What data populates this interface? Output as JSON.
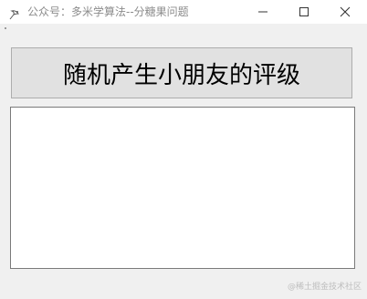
{
  "window": {
    "title": "公众号：多米学算法--分糖果问题",
    "icon": "app-feather-icon"
  },
  "controls": {
    "minimize_icon": "minimize-icon",
    "maximize_icon": "maximize-icon",
    "close_icon": "close-icon"
  },
  "main": {
    "generate_button_label": "随机产生小朋友的评级",
    "output_text": ""
  },
  "watermark": "@稀土掘金技术社区"
}
